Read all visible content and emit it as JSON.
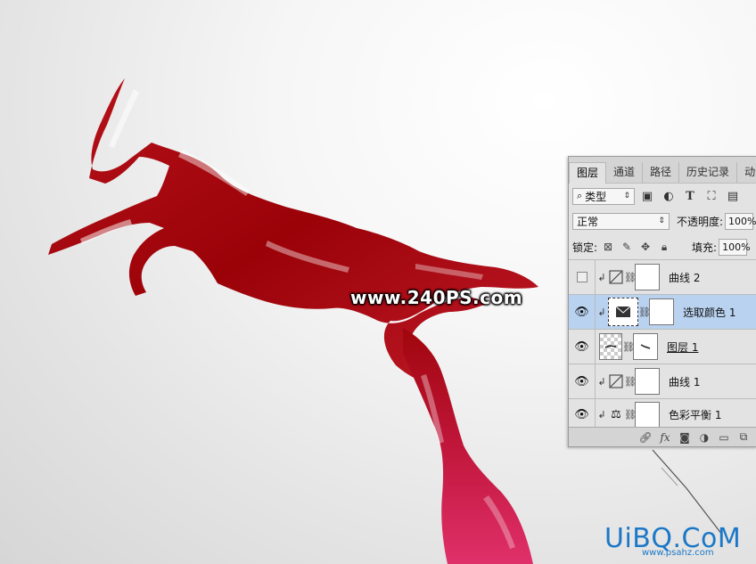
{
  "colors": {
    "horse": "#a0060c",
    "selected_layer": "#b9d2f0",
    "brand": "#1b78c7"
  },
  "watermark": "www.240PS.com",
  "brand": {
    "main": "UiBQ.CoM",
    "sub": "www.psahz.com"
  },
  "panel": {
    "tabs": [
      "图层",
      "通道",
      "路径",
      "历史记录",
      "动作"
    ],
    "filter": {
      "value": "类型",
      "icon": "search-icon"
    },
    "blend_mode": "正常",
    "opacity_label": "不透明度:",
    "opacity_value": "100%",
    "lock_label": "锁定:",
    "fill_label": "填充:",
    "fill_value": "100%",
    "layers": [
      {
        "name": "曲线 2",
        "visible": false,
        "type": "curves"
      },
      {
        "name": "选取颜色 1",
        "visible": true,
        "type": "selective-color",
        "selected": true
      },
      {
        "name": "图层 1",
        "visible": true,
        "type": "pixel"
      },
      {
        "name": "曲线 1",
        "visible": true,
        "type": "curves"
      },
      {
        "name": "色彩平衡 1",
        "visible": true,
        "type": "color-balance"
      }
    ]
  }
}
